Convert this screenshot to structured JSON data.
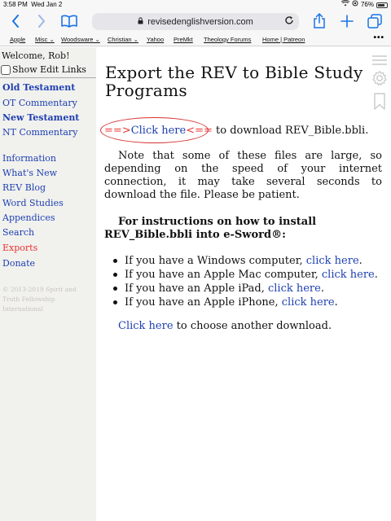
{
  "status_bar": {
    "time": "3:58 PM",
    "date": "Wed Jan 2",
    "battery": "76%",
    "battery_level": 0.76
  },
  "url_bar": {
    "domain": "revisedenglishversion.com"
  },
  "bookmarks": [
    {
      "label": "Apple"
    },
    {
      "label": "Misc ⌄"
    },
    {
      "label": "Woodsware ⌄"
    },
    {
      "label": "Christian ⌄"
    },
    {
      "label": "Yahoo"
    },
    {
      "label": "PreMkt"
    },
    {
      "label": "Theology Forums"
    },
    {
      "label": "Home | Patreon"
    }
  ],
  "sidebar": {
    "welcome": "Welcome, Rob!",
    "show_edit_links": "Show Edit Links",
    "testament_links": [
      {
        "label": "Old Testament"
      },
      {
        "label": "OT Commentary"
      },
      {
        "label": "New Testament"
      },
      {
        "label": "NT Commentary"
      }
    ],
    "nav_links": [
      {
        "label": "Information"
      },
      {
        "label": "What's New"
      },
      {
        "label": "REV Blog"
      },
      {
        "label": "Word Studies"
      },
      {
        "label": "Appendices"
      },
      {
        "label": "Search"
      },
      {
        "label": "Exports"
      },
      {
        "label": "Donate"
      }
    ],
    "copyright": "© 2013-2019 Spirit and Truth Fellowship International"
  },
  "main": {
    "title": "Export the REV to Bible Study Programs",
    "download": {
      "arrow_left": "==>",
      "link": "Click here",
      "arrow_right": "<==",
      "suffix": " to download REV_Bible.bbli."
    },
    "note": "Note that some of these files are large, so depending on the speed of your internet connection, it may take several seconds to download the file. Please be patient.",
    "instructions": "For instructions on how to install REV_Bible.bbli into e-Sword®:",
    "items": [
      {
        "prefix": "If you have a Windows computer, ",
        "link": "click here",
        "suffix": "."
      },
      {
        "prefix": "If you have an Apple Mac computer, ",
        "link": "click here",
        "suffix": "."
      },
      {
        "prefix": "If you have an Apple iPad, ",
        "link": "click here",
        "suffix": "."
      },
      {
        "prefix": "If you have an Apple iPhone, ",
        "link": "click here",
        "suffix": "."
      }
    ],
    "another": {
      "link": "Click here",
      "suffix": " to choose another download."
    }
  },
  "colors": {
    "link": "#1d3fb0",
    "active": "#e8322f",
    "sidebar_bg": "#f1f1ee",
    "ios_blue": "#1a73e8"
  }
}
